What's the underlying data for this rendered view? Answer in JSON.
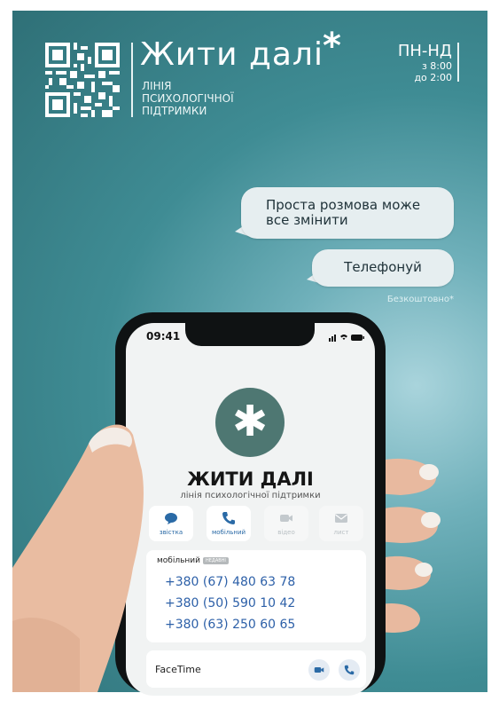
{
  "brand": {
    "title": "Жити далі",
    "asterisk": "*",
    "subtitle_lines": [
      "ЛІНІЯ",
      "ПСИХОЛОГІЧНОЇ",
      "ПІДТРИМКИ"
    ]
  },
  "hours": {
    "days": "ПН-НД",
    "from": "з 8:00",
    "to": "до 2:00"
  },
  "bubbles": {
    "first_line1": "Проста розмова може",
    "first_line2": "все змінити",
    "second": "Телефонуй"
  },
  "free_note": "Безкоштовно*",
  "phone": {
    "time": "09:41",
    "logo_symbol": "✱",
    "contact_name": "ЖИТИ ДАЛІ",
    "contact_sub": "лінія психологічної підтримки",
    "actions": [
      {
        "label": "звістка",
        "icon": "message-icon"
      },
      {
        "label": "мобільний",
        "icon": "phone-icon"
      },
      {
        "label": "відео",
        "icon": "video-icon"
      },
      {
        "label": "лист",
        "icon": "mail-icon"
      }
    ],
    "mobile_label": "мобільний",
    "badge": "НЕДАВНІ",
    "numbers": [
      "+380 (67) 480 63 78",
      "+380 (50) 590 10 42",
      "+380 (63) 250 60 65"
    ],
    "facetime": "FaceTime"
  },
  "colors": {
    "accent": "#2d60a8",
    "brand_green": "#4e7772",
    "bubble": "#e6eef0"
  }
}
